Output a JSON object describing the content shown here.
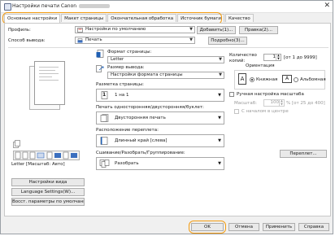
{
  "window": {
    "title": "Настройки печати Canon",
    "close_glyph": "✕"
  },
  "tabs": [
    {
      "label": "Основные настройки"
    },
    {
      "label": "Макет страницы"
    },
    {
      "label": "Окончательная обработка"
    },
    {
      "label": "Источник бумаги"
    },
    {
      "label": "Качество"
    }
  ],
  "profile": {
    "label": "Профиль:",
    "value": "Настройки по умолчанию",
    "add_button": "Добавить(1)...",
    "edit_button": "Правка(2)..."
  },
  "output": {
    "label": "Способ вывода:",
    "value": "Печать",
    "details_button": "Подробно(3)..."
  },
  "preview": {
    "caption": "Letter [Масштаб: Авто]",
    "view_settings_button": "Настройки вида",
    "language_button": "Language Settings(W)...",
    "restore_defaults_button": "Восст. параметры по умолчанию"
  },
  "page_format": {
    "label": "Формат страницы:",
    "value": "Letter"
  },
  "output_size": {
    "label": "Размер вывода:",
    "value": "Настройки формата страницы"
  },
  "copies": {
    "label": "Количество копий:",
    "value": "1",
    "range": "[от 1 до 9999]"
  },
  "orientation": {
    "label": "Ориентация",
    "portrait_label": "Книжная",
    "landscape_label": "Альбомная",
    "portrait_glyph": "A",
    "landscape_glyph": "A"
  },
  "page_layout": {
    "label": "Разметка страницы:",
    "value": "1 на 1",
    "glyph": "1"
  },
  "manual_scale": {
    "label": "Ручная настройка масштаба",
    "scale_label": "Масштаб:",
    "value": "100",
    "unit_range": "% [от 25 до 400]",
    "center_label": "С началом в центре"
  },
  "duplex": {
    "label": "Печать односторонняя/двусторонняя/буклет:",
    "value": "Двусторонняя печать"
  },
  "binding": {
    "label": "Расположение переплета:",
    "value": "Длинный край [слева]",
    "binding_button": "Переплет..."
  },
  "collate": {
    "label": "Сшивание/Разобрать/Группирование:",
    "value": "Разобрать"
  },
  "footer": {
    "ok": "OK",
    "cancel": "Отмена",
    "apply": "Применить",
    "help": "Справка"
  },
  "colors": {
    "highlight": "#f39c12",
    "accent_blue": "#1e5fb4",
    "printer_blue": "#3b6fbf"
  }
}
